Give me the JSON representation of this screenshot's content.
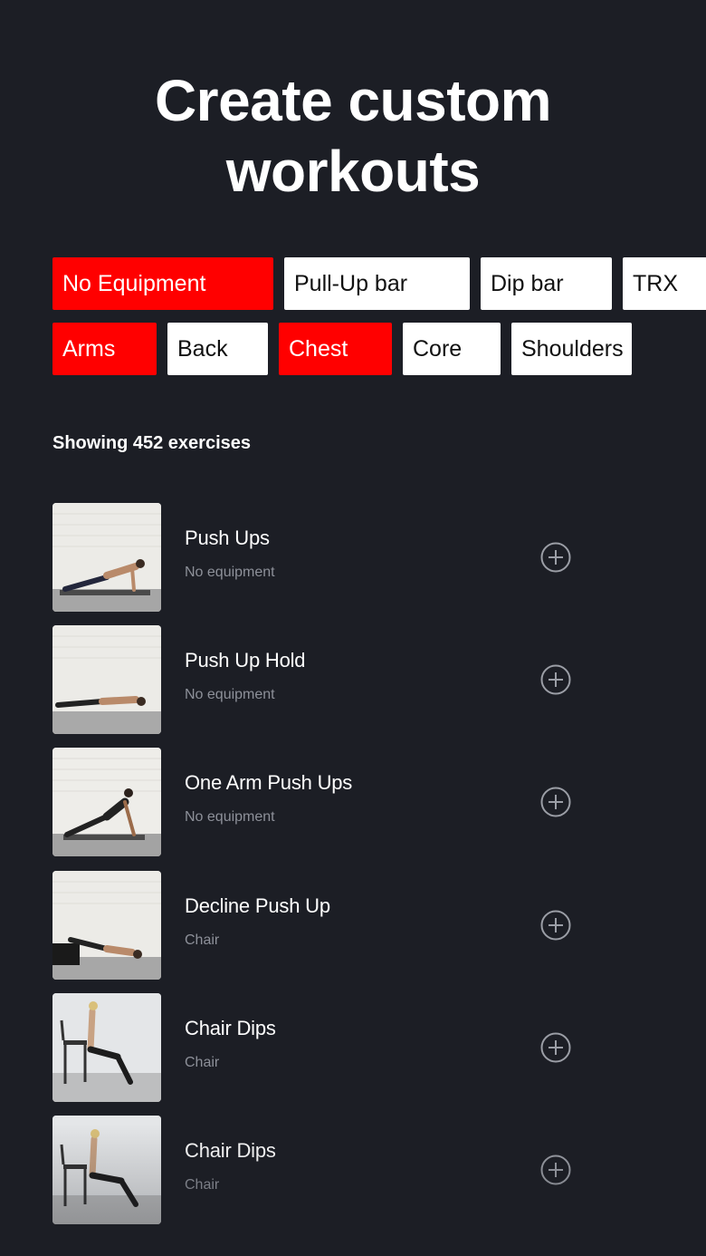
{
  "header": {
    "title_line1": "Create custom",
    "title_line2": "workouts"
  },
  "colors": {
    "background": "#1c1e25",
    "accent": "#ff0000",
    "chip_inactive": "#ffffff"
  },
  "filters": {
    "equipment": [
      {
        "label": "No Equipment",
        "active": true
      },
      {
        "label": "Pull-Up bar",
        "active": false
      },
      {
        "label": "Dip bar",
        "active": false
      },
      {
        "label": "TRX",
        "active": false
      }
    ],
    "muscles": [
      {
        "label": "Arms",
        "active": true
      },
      {
        "label": "Back",
        "active": false
      },
      {
        "label": "Chest",
        "active": true
      },
      {
        "label": "Core",
        "active": false
      },
      {
        "label": "Shoulders",
        "active": false
      }
    ]
  },
  "results": {
    "count_text": "Showing 452 exercises"
  },
  "exercises": [
    {
      "name": "Push Ups",
      "equipment": "No equipment",
      "icon": "add-circle-icon"
    },
    {
      "name": "Push Up Hold",
      "equipment": "No equipment",
      "icon": "add-circle-icon"
    },
    {
      "name": "One Arm Push Ups",
      "equipment": "No equipment",
      "icon": "add-circle-icon"
    },
    {
      "name": "Decline Push Up",
      "equipment": "Chair",
      "icon": "add-circle-icon"
    },
    {
      "name": "Chair Dips",
      "equipment": "Chair",
      "icon": "add-circle-icon"
    },
    {
      "name": "Chair Dips",
      "equipment": "Chair",
      "icon": "add-circle-icon"
    }
  ]
}
